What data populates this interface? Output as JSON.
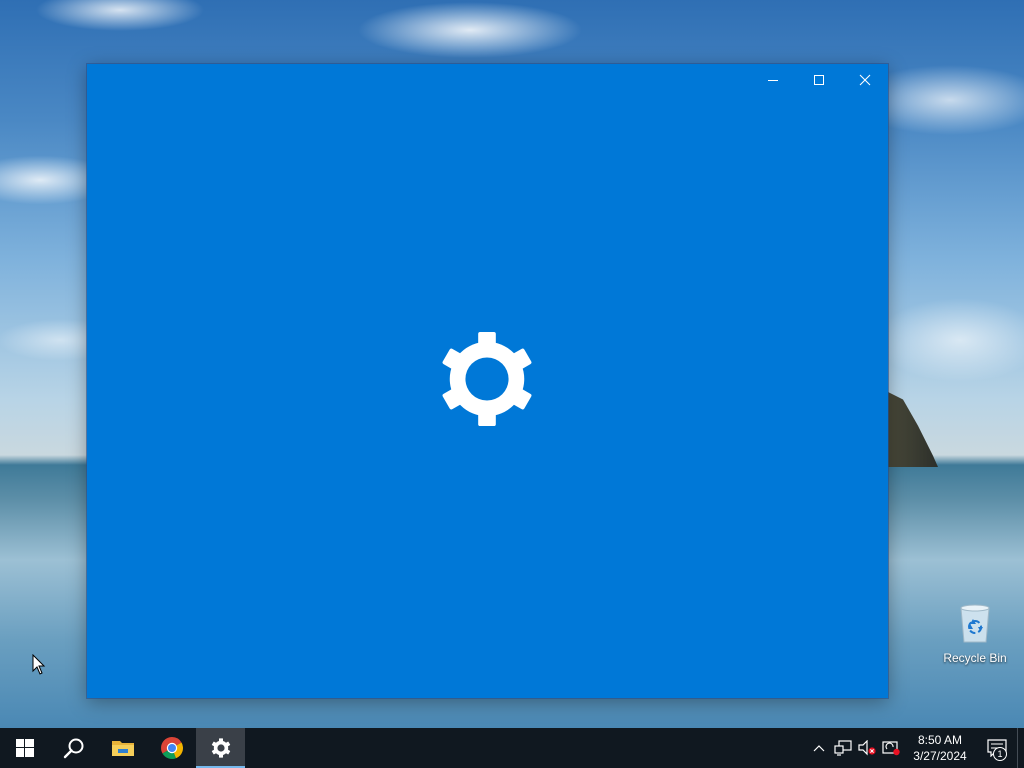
{
  "desktop": {
    "icons": [
      {
        "label": "Recycle Bin",
        "icon": "recycle-bin-icon"
      }
    ]
  },
  "window": {
    "app": "Settings",
    "state": "loading-splash",
    "background_color": "#0078d7",
    "splash_icon": "gear-icon",
    "controls": {
      "minimize_icon": "minimize-icon",
      "maximize_icon": "maximize-icon",
      "close_icon": "close-icon"
    }
  },
  "taskbar": {
    "background_color": "#101820",
    "accent_color": "#76b9ed",
    "items": [
      {
        "name": "start-button",
        "icon": "windows-logo-icon"
      },
      {
        "name": "search-button",
        "icon": "search-icon"
      },
      {
        "name": "file-explorer",
        "icon": "folder-icon"
      },
      {
        "name": "chrome",
        "icon": "chrome-icon"
      },
      {
        "name": "settings",
        "icon": "gear-icon",
        "active": true
      }
    ],
    "tray": {
      "icons": [
        "chevron-up-icon",
        "network-icon",
        "volume-muted-icon",
        "update-alert-icon"
      ],
      "clock": {
        "time": "8:50 AM",
        "date": "3/27/2024"
      },
      "notifications": {
        "icon": "action-center-icon",
        "count": "1"
      }
    }
  }
}
